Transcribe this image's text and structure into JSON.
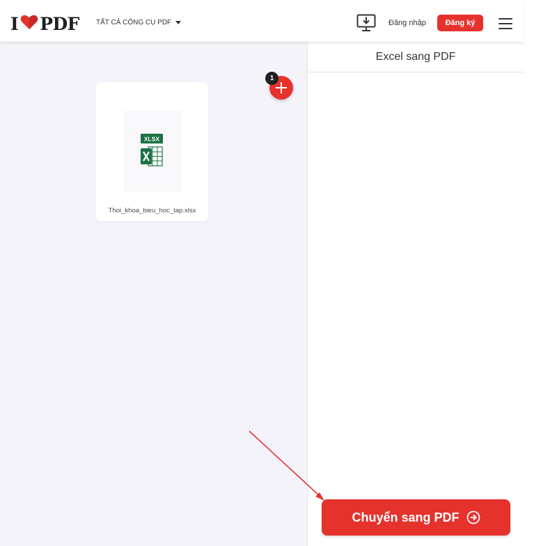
{
  "header": {
    "logo_left": "I",
    "logo_right": "PDF",
    "tools_menu_label": "TẤT CẢ CÔNG CỤ PDF",
    "login_label": "Đăng nhập",
    "signup_label": "Đăng ký"
  },
  "workspace": {
    "file_count": "1",
    "file": {
      "icon_text": "XLSX",
      "name": "Thoi_khoa_bieu_hoc_tap.xlsx"
    }
  },
  "sidebar": {
    "title": "Excel sang PDF",
    "convert_label": "Chuyển sang PDF"
  },
  "colors": {
    "brand_red": "#e5322d",
    "excel_green": "#1e7145",
    "workspace_bg": "#f4f3f9",
    "annotation_arrow": "#e5322d"
  },
  "icons": [
    "heart-icon",
    "caret-down-icon",
    "desktop-download-icon",
    "hamburger-icon",
    "plus-icon",
    "xlsx-file-icon",
    "arrow-circle-right-icon"
  ]
}
